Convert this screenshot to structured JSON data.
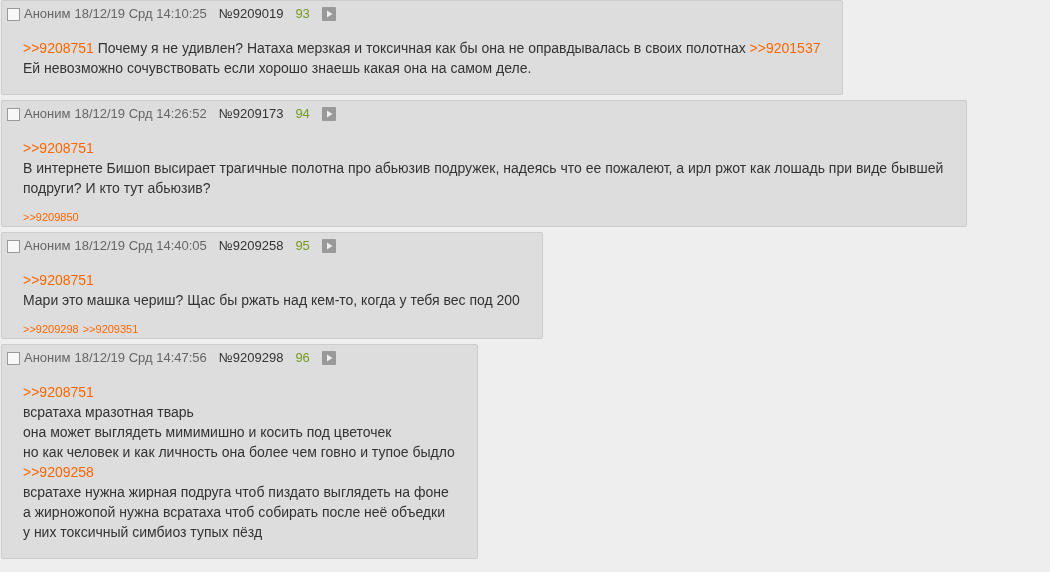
{
  "posts": [
    {
      "checked": false,
      "author": "Аноним",
      "date": "18/12/19 Срд 14:10:25",
      "number": "№9209019",
      "count": "93",
      "body": [
        [
          {
            "kind": "link",
            "text": ">>9208751"
          },
          {
            "kind": "text",
            "text": " Почему я не удивлен? Натаха мерзкая и токсичная как бы она не оправдывалась в своих полотнах "
          },
          {
            "kind": "link",
            "text": ">>9201537"
          }
        ],
        [
          {
            "kind": "text",
            "text": "Ей невозможно сочувствовать если хорошо знаешь какая она на самом деле."
          }
        ]
      ]
    },
    {
      "checked": false,
      "author": "Аноним",
      "date": "18/12/19 Срд 14:26:52",
      "number": "№9209173",
      "count": "94",
      "body": [
        [
          {
            "kind": "link",
            "text": ">>9208751"
          }
        ],
        [
          {
            "kind": "text",
            "text": "В интернете Бишоп высирает трагичные полотна про абьюзив подружек, надеясь что ее пожалеют, а ирл ржот как лошадь при виде бывшей подруги? И кто тут абьюзив?"
          }
        ]
      ],
      "replies": [
        ">>9209850"
      ]
    },
    {
      "checked": false,
      "author": "Аноним",
      "date": "18/12/19 Срд 14:40:05",
      "number": "№9209258",
      "count": "95",
      "body": [
        [
          {
            "kind": "link",
            "text": ">>9208751"
          }
        ],
        [
          {
            "kind": "text",
            "text": "Мари это машка чериш? Щас бы ржать над кем-то, когда у тебя вес под 200"
          }
        ]
      ],
      "replies": [
        ">>9209298",
        ">>9209351"
      ]
    },
    {
      "checked": false,
      "author": "Аноним",
      "date": "18/12/19 Срд 14:47:56",
      "number": "№9209298",
      "count": "96",
      "body": [
        [
          {
            "kind": "link",
            "text": ">>9208751"
          }
        ],
        [
          {
            "kind": "text",
            "text": "всратаха мразотная тварь"
          }
        ],
        [
          {
            "kind": "text",
            "text": "она может выглядеть мимимишно и косить под цветочек"
          }
        ],
        [
          {
            "kind": "text",
            "text": "но как человек и как личность она более чем говно и тупое быдло"
          }
        ],
        [
          {
            "kind": "link",
            "text": ">>9209258"
          }
        ],
        [
          {
            "kind": "text",
            "text": "всратахе нужна жирная подруга чтоб пиздато выглядеть на фоне"
          }
        ],
        [
          {
            "kind": "text",
            "text": "а жирножопой нужна всратаха чтоб собирать после неё объедки"
          }
        ],
        [
          {
            "kind": "text",
            "text": "у них токсичный симбиоз тупых пёзд"
          }
        ]
      ]
    }
  ]
}
